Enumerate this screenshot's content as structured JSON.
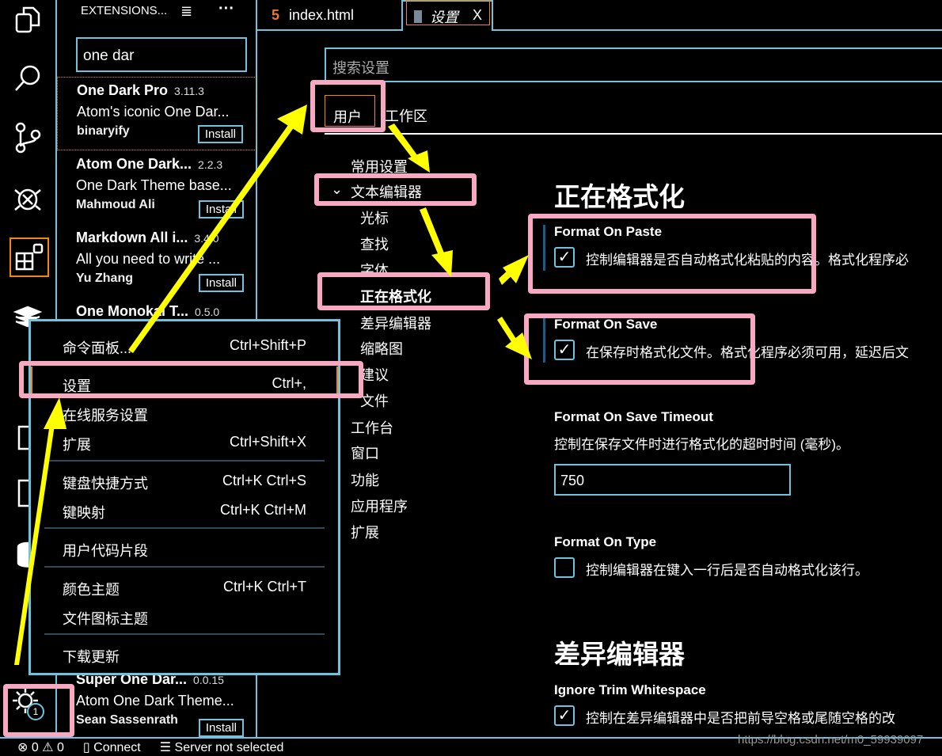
{
  "activity_bar": {
    "icons": [
      "explorer-icon",
      "search-icon",
      "source-control-icon",
      "debug-icon",
      "extensions-icon",
      "docker-icon",
      "remote-icon",
      "bookmark-icon",
      "database-icon"
    ],
    "manage_badge": "1"
  },
  "sidebar": {
    "title": "EXTENSIONS...",
    "search_value": "one dar",
    "extensions": [
      {
        "name": "One Dark Pro",
        "version": "3.11.3",
        "desc": "Atom's iconic One Dar...",
        "publisher": "binaryify",
        "action": "Install"
      },
      {
        "name": "Atom One Dark...",
        "version": "2.2.3",
        "desc": "One Dark Theme base...",
        "publisher": "Mahmoud Ali",
        "action": "Install"
      },
      {
        "name": "Markdown All i...",
        "version": "3.4.0",
        "desc": "All you need to write ...",
        "publisher": "Yu Zhang",
        "action": "Install"
      },
      {
        "name": "One Monokai T...",
        "version": "0.5.0"
      },
      {
        "name": "Super One Dar...",
        "version": "0.0.15",
        "desc": "Atom One Dark Theme...",
        "publisher": "Sean Sassenrath",
        "action": "Install"
      }
    ]
  },
  "tabs": [
    {
      "label": "index.html"
    },
    {
      "label": "设置",
      "close": "X"
    }
  ],
  "settings": {
    "search_placeholder": "搜索设置",
    "scope_tabs": [
      "用户",
      "工作区"
    ],
    "nav": {
      "common": "常用设置",
      "text_editor": "文本编辑器",
      "sub": [
        "光标",
        "查找",
        "字体",
        "正在格式化",
        "差异编辑器",
        "缩略图",
        "建议",
        "文件"
      ],
      "rest": [
        "工作台",
        "窗口",
        "功能",
        "应用程序",
        "扩展"
      ]
    },
    "section1": "正在格式化",
    "items": [
      {
        "title": "Format On Paste",
        "desc": "控制编辑器是否自动格式化粘贴的内容。格式化程序必",
        "checked": true
      },
      {
        "title": "Format On Save",
        "desc": "在保存时格式化文件。格式化程序必须可用，延迟后文",
        "checked": true
      },
      {
        "title": "Format On Save Timeout",
        "desc": "控制在保存文件时进行格式化的超时时间 (毫秒)。",
        "value": "750"
      },
      {
        "title": "Format On Type",
        "desc": "控制编辑器在键入一行后是否自动格式化该行。",
        "checked": false
      }
    ],
    "section2": "差异编辑器",
    "item_diff": {
      "title": "Ignore Trim Whitespace",
      "desc": "控制在差异编辑器中是否把前导空格或尾随空格的改",
      "checked": true
    }
  },
  "menu": {
    "items": [
      {
        "label": "命令面板...",
        "key": "Ctrl+Shift+P"
      },
      {
        "label": "设置",
        "key": "Ctrl+,"
      },
      {
        "label": "在线服务设置",
        "key": ""
      },
      {
        "label": "扩展",
        "key": "Ctrl+Shift+X"
      },
      {
        "label": "键盘快捷方式",
        "key": "Ctrl+K Ctrl+S"
      },
      {
        "label": "键映射",
        "key": "Ctrl+K Ctrl+M"
      },
      {
        "label": "用户代码片段",
        "key": ""
      },
      {
        "label": "颜色主题",
        "key": "Ctrl+K Ctrl+T"
      },
      {
        "label": "文件图标主题",
        "key": ""
      },
      {
        "label": "下载更新",
        "key": ""
      }
    ]
  },
  "status": {
    "errors": "0",
    "warnings": "0",
    "connect": "Connect",
    "server": "Server not selected"
  },
  "watermark": "https://blog.csdn.net/m0_59939097",
  "colors": {
    "border": "#6fc3df",
    "focus": "#f38518",
    "annotation_box": "#f9a8c4",
    "annotation_arrow": "#ffff00"
  }
}
